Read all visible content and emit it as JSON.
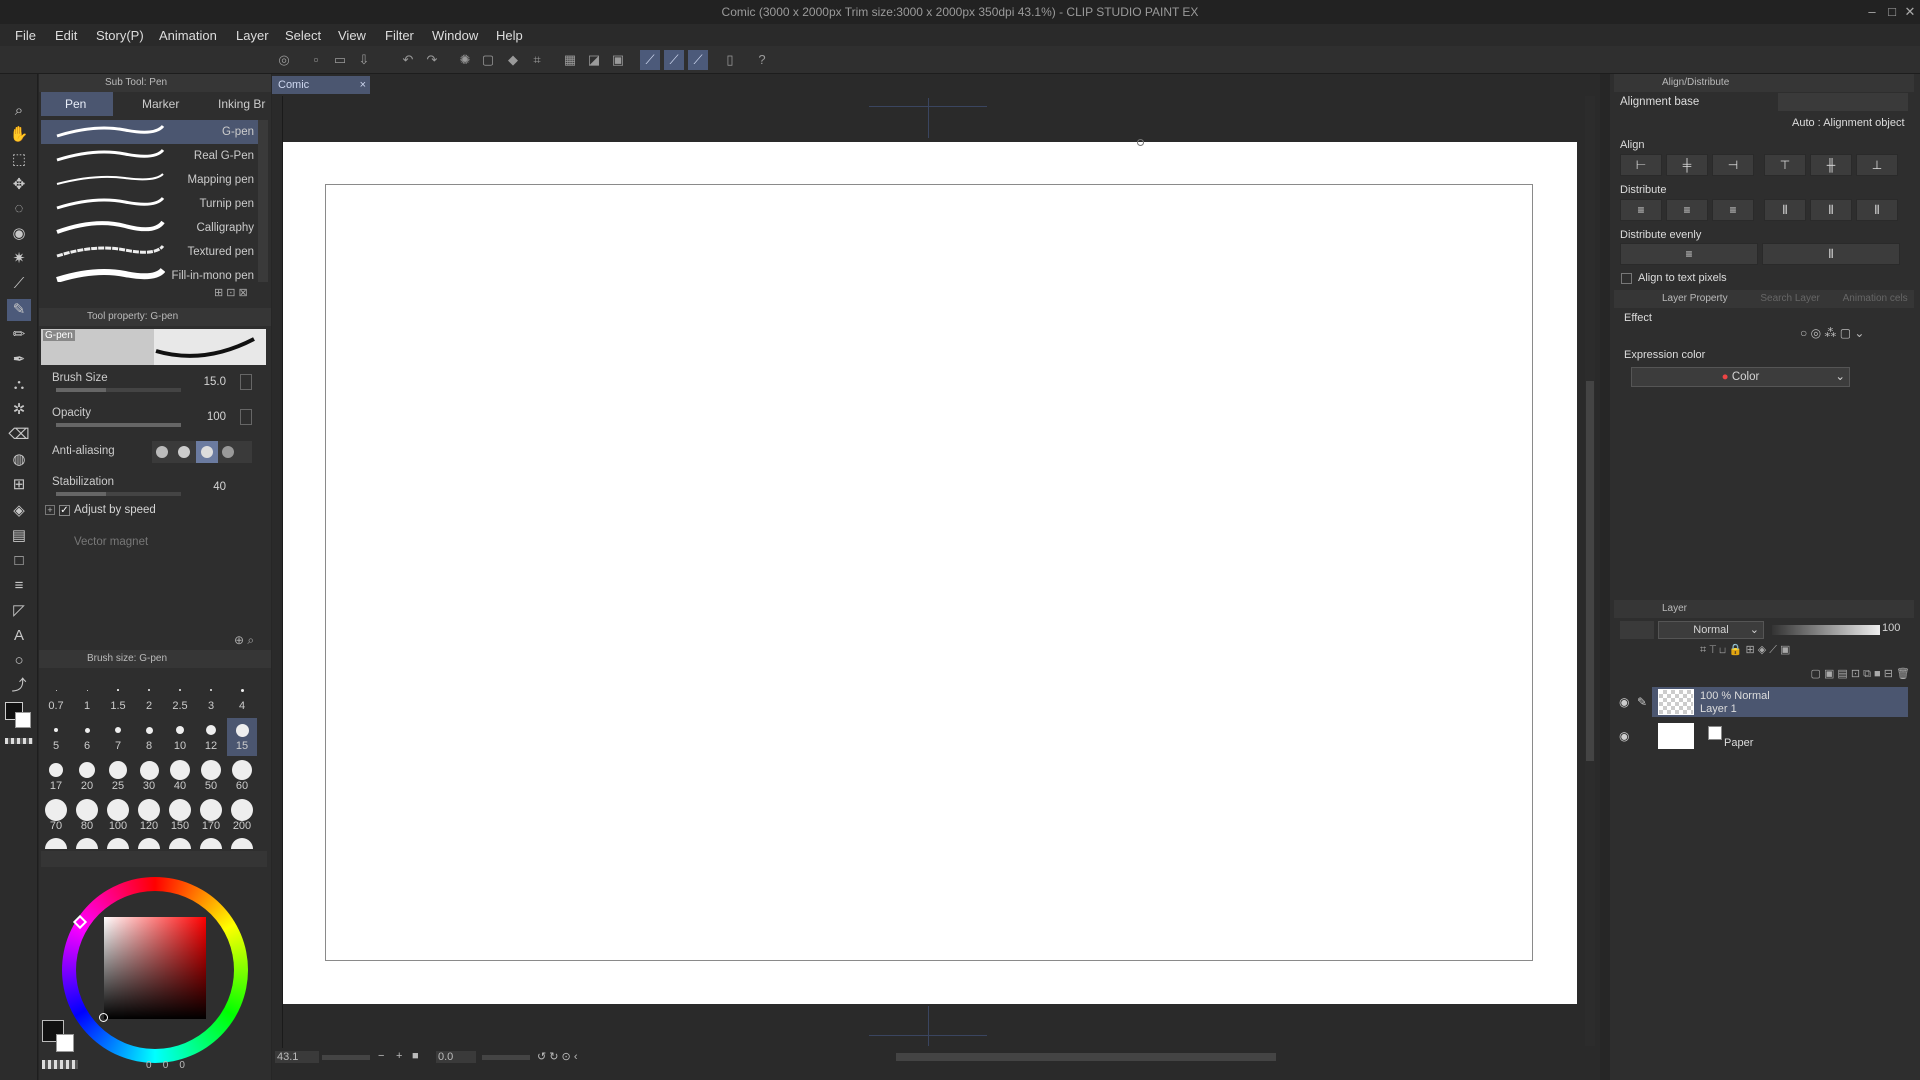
{
  "window": {
    "title": "Comic (3000 x 2000px Trim size:3000 x 2000px 350dpi 43.1%) - CLIP STUDIO PAINT EX",
    "min": "–",
    "max": "□",
    "close": "✕"
  },
  "menu": [
    "File",
    "Edit",
    "Story(P)",
    "Animation",
    "Layer",
    "Select",
    "View",
    "Filter",
    "Window",
    "Help"
  ],
  "sub_tool": {
    "header": "Sub Tool: Pen",
    "tabs": [
      "Pen",
      "Marker",
      "Inking Br"
    ],
    "pens": [
      "G-pen",
      "Real G-Pen",
      "Mapping pen",
      "Turnip pen",
      "Calligraphy",
      "Textured pen",
      "Fill-in-mono pen"
    ],
    "selected": "G-pen"
  },
  "tool_property": {
    "header": "Tool property: G-pen",
    "preview_label": "G-pen",
    "brush_size_label": "Brush Size",
    "brush_size_value": "15.0",
    "brush_size_fraction": 0.4,
    "opacity_label": "Opacity",
    "opacity_value": "100",
    "opacity_fraction": 1.0,
    "anti_aliasing_label": "Anti-aliasing",
    "stabilization_label": "Stabilization",
    "stabilization_value": "40",
    "stabilization_fraction": 0.4,
    "adjust_by_speed": "Adjust by speed",
    "vector_magnet": "Vector magnet"
  },
  "brush_size": {
    "header": "Brush size: G-pen",
    "sizes": [
      "0.7",
      "1",
      "1.5",
      "2",
      "2.5",
      "3",
      "4",
      "5",
      "6",
      "7",
      "8",
      "10",
      "12",
      "15",
      "17",
      "20",
      "25",
      "30",
      "40",
      "50",
      "60",
      "70",
      "80",
      "100",
      "120",
      "150",
      "170",
      "200"
    ],
    "selected": "15"
  },
  "canvas": {
    "tab_label": "Comic",
    "tab_close": "×"
  },
  "status": {
    "zoom": "43.1",
    "angle": "0.0"
  },
  "color_panel": {
    "values": [
      "0",
      "0",
      "0"
    ]
  },
  "align_panel": {
    "header": "Align/Distribute",
    "alignment_base": "Alignment base",
    "auto_label": "Auto : Alignment object",
    "align": "Align",
    "distribute": "Distribute",
    "distribute_evenly": "Distribute evenly",
    "align_to_text_pixels": "Align to text pixels"
  },
  "layer_property": {
    "header": "Layer Property",
    "tab2": "Search Layer",
    "tab3": "Animation cels",
    "effect": "Effect",
    "expression_color": "Expression color",
    "color_value": "Color"
  },
  "layer_panel": {
    "header": "Layer",
    "blend_mode": "Normal",
    "opacity": "100",
    "layers": [
      {
        "line1": "100 % Normal",
        "line2": "Layer 1"
      },
      {
        "line1": "",
        "line2": "Paper"
      }
    ]
  },
  "colors": {
    "accent": "#4b5670",
    "bg": "#2e2e2e",
    "paper": "#ffffff"
  }
}
